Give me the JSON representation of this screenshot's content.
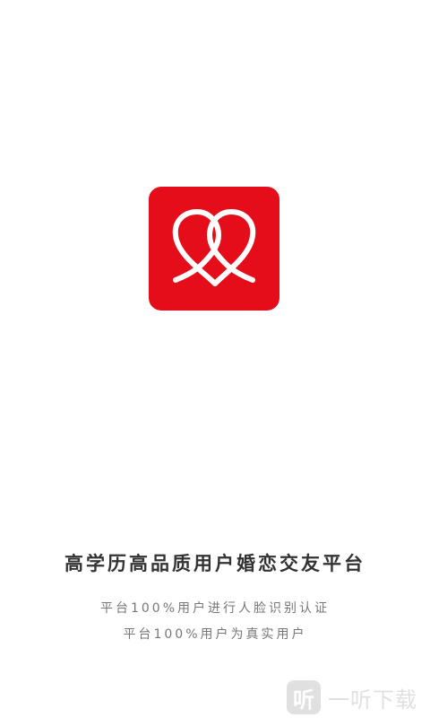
{
  "brand": {
    "logo_icon": "knotted-heart-icon",
    "logo_color": "#e60d1a"
  },
  "slogan": {
    "title": "高学历高品质用户婚恋交友平台",
    "line1": "平台100%用户进行人脸识别认证",
    "line2": "平台100%用户为真实用户"
  },
  "watermark": {
    "badge_text": "听",
    "text": "一听下载"
  }
}
